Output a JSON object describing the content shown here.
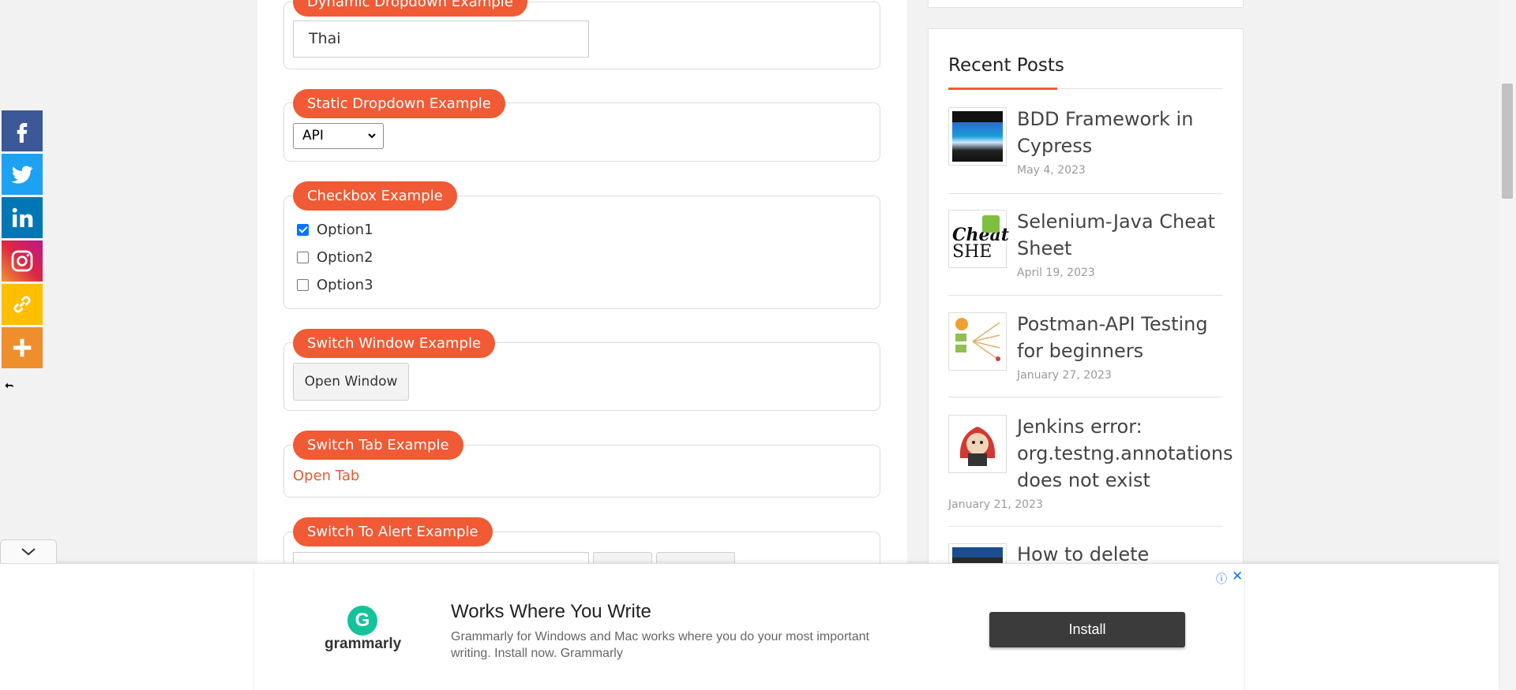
{
  "main": {
    "dynamic_dropdown": {
      "legend": "Dynamic Dropdown Example",
      "value": "Thai"
    },
    "static_dropdown": {
      "legend": "Static Dropdown Example",
      "selected": "API"
    },
    "checkbox": {
      "legend": "Checkbox Example",
      "options": [
        {
          "label": "Option1",
          "checked": true
        },
        {
          "label": "Option2",
          "checked": false
        },
        {
          "label": "Option3",
          "checked": false
        }
      ]
    },
    "switch_window": {
      "legend": "Switch Window Example",
      "button": "Open Window"
    },
    "switch_tab": {
      "legend": "Switch Tab Example",
      "link": "Open Tab"
    },
    "switch_alert": {
      "legend": "Switch To Alert Example"
    }
  },
  "sidebar": {
    "title": "Recent Posts",
    "posts": [
      {
        "title": "BDD Framework in Cypress",
        "date": "May 4, 2023"
      },
      {
        "title": "Selenium-Java Cheat Sheet",
        "date": "April 19, 2023"
      },
      {
        "title": "Postman-API Testing for beginners",
        "date": "January 27, 2023"
      },
      {
        "title": "Jenkins error: org.testng.annotations does not exist",
        "date": "January 21, 2023"
      },
      {
        "title": "How to delete previous",
        "date": ""
      }
    ]
  },
  "share": {
    "icons": [
      "facebook-icon",
      "twitter-icon",
      "linkedin-icon",
      "instagram-icon",
      "copy-link-icon",
      "more-icon"
    ],
    "colors": {
      "facebook": "#3b5998",
      "twitter": "#1da1f2",
      "linkedin": "#0077b5",
      "instagram": "#c13584",
      "copy_link": "#ffbe00",
      "more": "#ee8e2d"
    }
  },
  "ad": {
    "brand": "grammarly",
    "logo_letter": "G",
    "headline": "Works Where You Write",
    "body": "Grammarly for Windows and Mac works where you do your most important writing. Install now. Grammarly",
    "cta": "Install",
    "info_glyph": "ⓘ",
    "close_glyph": "✕"
  },
  "colors": {
    "accent": "#f05a35",
    "link": "#e35b33"
  }
}
